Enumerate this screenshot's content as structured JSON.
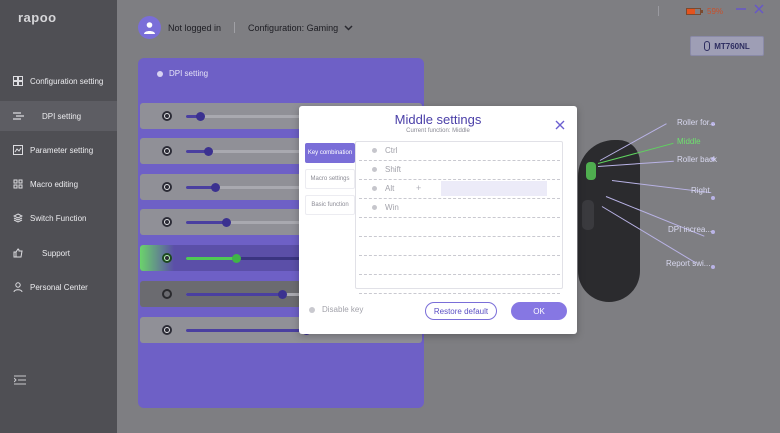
{
  "app": {
    "logo": "rapoo",
    "brand_color": "#7a6ed8"
  },
  "sidebar": {
    "items": [
      {
        "label": "Configuration setting",
        "icon": "grid-icon"
      },
      {
        "label": "DPI setting",
        "icon": "dpi-icon",
        "active": true
      },
      {
        "label": "Parameter setting",
        "icon": "parameter-icon"
      },
      {
        "label": "Macro editing",
        "icon": "macro-icon"
      },
      {
        "label": "Switch Function",
        "icon": "layers-icon"
      },
      {
        "label": "Support",
        "icon": "thumbs-up-icon"
      },
      {
        "label": "Personal Center",
        "icon": "person-icon"
      }
    ],
    "collapse_icon": "collapse-icon"
  },
  "header": {
    "user_status": "Not logged in",
    "configuration": "Configuration: Gaming",
    "battery_percent": "59%",
    "battery_level": 0.59,
    "device_name": "MT760NL"
  },
  "dpi_panel": {
    "title": "DPI setting",
    "levels": [
      {
        "level": 0.12,
        "selected": false
      },
      {
        "level": 0.18,
        "selected": false
      },
      {
        "level": 0.24,
        "selected": false
      },
      {
        "level": 0.33,
        "selected": false
      },
      {
        "level": 0.42,
        "selected": true
      },
      {
        "level": 0.8,
        "selected": false,
        "disabled": true
      },
      {
        "level": 1.0,
        "selected": false
      }
    ]
  },
  "mouse_buttons": {
    "roller_forward": "Roller for...",
    "middle": "Middle",
    "roller_back": "Roller back",
    "right": "Right",
    "dpi_increase": "DPI increa...",
    "report_switch": "Report swi..."
  },
  "modal": {
    "title": "Middle settings",
    "subtitle": "Current function: Middle",
    "tabs": [
      "Key combination",
      "Macro settings",
      "Basic function"
    ],
    "keys": [
      "Ctrl",
      "Shift",
      "Alt",
      "Win"
    ],
    "plus": "+",
    "disable_key": "Disable key",
    "restore_default": "Restore default",
    "ok": "OK"
  }
}
